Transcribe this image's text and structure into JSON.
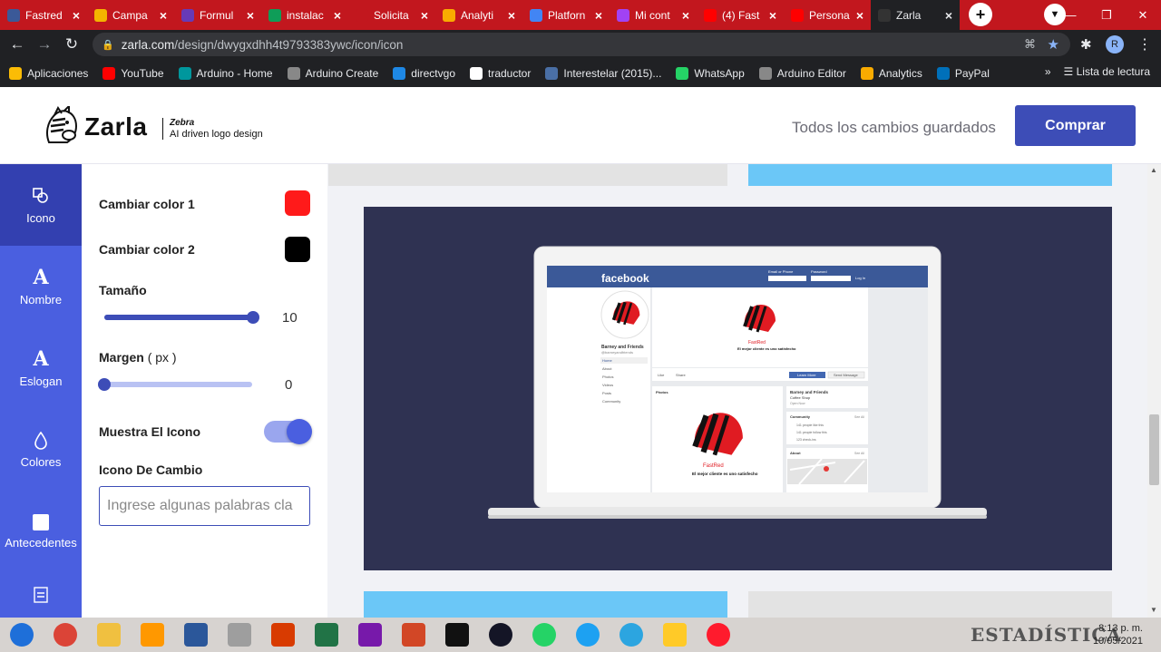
{
  "browser": {
    "tabs": [
      {
        "label": "Fastred",
        "color": "#3b5998"
      },
      {
        "label": "Campa",
        "color": "#f4b400"
      },
      {
        "label": "Formul",
        "color": "#673ab7"
      },
      {
        "label": "instalac",
        "color": "#0f9d58"
      },
      {
        "label": "Solicita",
        "color": "#c2171e"
      },
      {
        "label": "Analyti",
        "color": "#f9ab00"
      },
      {
        "label": "Platforn",
        "color": "#4285f4"
      },
      {
        "label": "Mi cont",
        "color": "#a142f4"
      },
      {
        "label": "(4) Fast",
        "color": "#ff0000"
      },
      {
        "label": "Persona",
        "color": "#ff0000"
      },
      {
        "label": "Zarla",
        "color": "#333333"
      }
    ],
    "url_domain": "zarla.com",
    "url_path": "/design/dwygxdhh4t9793383ywc/icon/icon",
    "bookmarks": [
      {
        "label": "Aplicaciones",
        "color": "#fbbc05"
      },
      {
        "label": "YouTube",
        "color": "#ff0000"
      },
      {
        "label": "Arduino - Home",
        "color": "#00979d"
      },
      {
        "label": "Arduino Create",
        "color": "#888888"
      },
      {
        "label": "directvgo",
        "color": "#1e88e5"
      },
      {
        "label": "traductor",
        "color": "#ffffff"
      },
      {
        "label": "Interestelar (2015)...",
        "color": "#4a6fa5"
      },
      {
        "label": "WhatsApp",
        "color": "#25d366"
      },
      {
        "label": "Arduino Editor",
        "color": "#888888"
      },
      {
        "label": "Analytics",
        "color": "#f9ab00"
      },
      {
        "label": "PayPal",
        "color": "#0070ba"
      }
    ],
    "reading_list": "Lista de lectura",
    "profile_initial": "R"
  },
  "app": {
    "brand_name": "Zarla",
    "brand_tag": "Zebra",
    "brand_tagline": "AI driven logo design",
    "save_status": "Todos los cambios guardados",
    "buy_label": "Comprar"
  },
  "rail": [
    {
      "label": "Icono",
      "icon": "shapes-icon",
      "glyph": "⬡"
    },
    {
      "label": "Nombre",
      "icon": "text-icon",
      "glyph": "A"
    },
    {
      "label": "Eslogan",
      "icon": "slogan-icon",
      "glyph": "A"
    },
    {
      "label": "Colores",
      "icon": "droplet-icon",
      "glyph": "💧"
    },
    {
      "label": "Antecedentes",
      "icon": "background-icon",
      "glyph": "■"
    }
  ],
  "panel": {
    "color1_label": "Cambiar color 1",
    "color1": "#ff1a1a",
    "color2_label": "Cambiar color 2",
    "color2": "#000000",
    "size_label": "Tamaño",
    "size_value": "10",
    "size_fraction": 1.0,
    "margin_label": "Margen",
    "margin_unit": "( px )",
    "margin_value": "0",
    "margin_fraction": 0.0,
    "show_icon_label": "Muestra El Icono",
    "show_icon": true,
    "change_icon_label": "Icono De Cambio",
    "search_placeholder": "Ingrese algunas palabras cla"
  },
  "mockup": {
    "site": "facebook",
    "login_email": "Email or Phone",
    "login_password": "Password",
    "login_button": "Log In",
    "page_name": "Barney and Friends",
    "page_handle": "@barneyandfriends",
    "nav": [
      "Home",
      "About",
      "Photos",
      "Videos",
      "Posts",
      "Community"
    ],
    "brand": "FastRed",
    "slogan": "El mejor cliente es uno satisfecho",
    "like": "Like",
    "share": "Share",
    "learn_more": "Learn More",
    "send_message": "Send Message",
    "photos": "Photos",
    "side_title": "Barney and Friends",
    "side_sub": "Coffee Shop",
    "side_link": "Open Now",
    "community": "Community",
    "see_all": "See All",
    "about": "About",
    "stats": [
      "141 people like this",
      "141 people follow this",
      "123 check-ins"
    ]
  },
  "taskbar": {
    "time": "8:13 p. m.",
    "date": "10/05/2021",
    "apps": [
      "start",
      "chrome",
      "explorer",
      "sublime",
      "word",
      "media",
      "office",
      "excel",
      "onenote",
      "powerpoint",
      "cmd",
      "speedtest",
      "whatsapp",
      "twitter",
      "telegram",
      "firebase",
      "opera"
    ],
    "bg_text": "ESTADÍSTICA"
  }
}
